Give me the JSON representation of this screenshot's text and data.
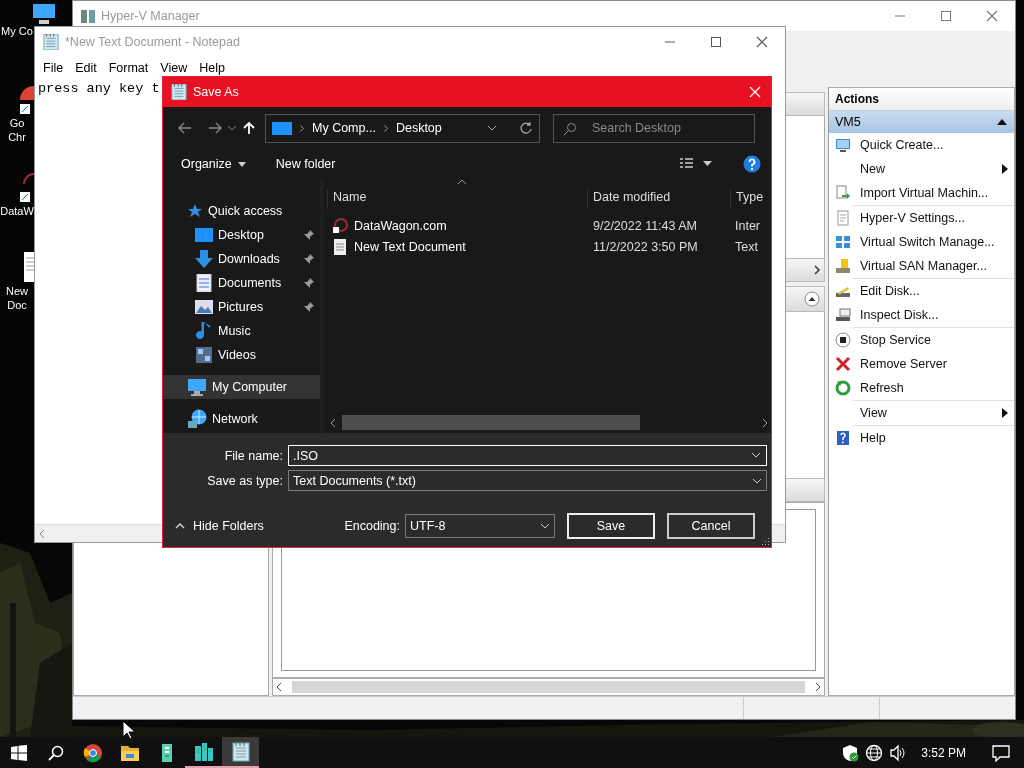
{
  "desktop": {
    "icons": [
      {
        "label": "My Co"
      },
      {
        "label": "Go Chr"
      },
      {
        "label": "DataW"
      },
      {
        "label": "New Doc"
      }
    ]
  },
  "hyperv": {
    "title": "Hyper-V Manager",
    "actions": {
      "title": "Actions",
      "group": "VM5",
      "groups": [
        {
          "items": [
            {
              "label": "Quick Create...",
              "submenu": false
            },
            {
              "label": "New",
              "submenu": true
            },
            {
              "label": "Import Virtual Machin...",
              "submenu": false
            }
          ]
        },
        {
          "items": [
            {
              "label": "Hyper-V Settings...",
              "submenu": false
            },
            {
              "label": "Virtual Switch Manage...",
              "submenu": false
            },
            {
              "label": "Virtual SAN Manager...",
              "submenu": false
            }
          ]
        },
        {
          "items": [
            {
              "label": "Edit Disk...",
              "submenu": false
            },
            {
              "label": "Inspect Disk...",
              "submenu": false
            }
          ]
        },
        {
          "items": [
            {
              "label": "Stop Service",
              "submenu": false
            },
            {
              "label": "Remove Server",
              "submenu": false
            },
            {
              "label": "Refresh",
              "submenu": false
            }
          ]
        },
        {
          "items": [
            {
              "label": "View",
              "submenu": true
            }
          ]
        },
        {
          "items": [
            {
              "label": "Help",
              "submenu": false
            }
          ]
        }
      ]
    }
  },
  "notepad": {
    "title": "*New Text Document - Notepad",
    "menu": [
      "File",
      "Edit",
      "Format",
      "View",
      "Help"
    ],
    "text": "press any key t"
  },
  "dialog": {
    "title": "Save As",
    "breadcrumb": [
      "My Comp...",
      "Desktop"
    ],
    "search": {
      "placeholder": "Search Desktop"
    },
    "toolbar": [
      "Organize",
      "New folder"
    ],
    "nav": [
      {
        "label": "Quick access",
        "selected": false,
        "children": [
          {
            "label": "Desktop",
            "pinned": true,
            "selected": false
          },
          {
            "label": "Downloads",
            "pinned": true,
            "selected": false
          },
          {
            "label": "Documents",
            "pinned": true,
            "selected": false
          },
          {
            "label": "Pictures",
            "pinned": true,
            "selected": false
          },
          {
            "label": "Music",
            "pinned": false,
            "selected": false
          },
          {
            "label": "Videos",
            "pinned": false,
            "selected": false
          }
        ]
      },
      {
        "label": "My Computer",
        "selected": true
      },
      {
        "label": "Network",
        "selected": false
      }
    ],
    "columns": [
      "Name",
      "Date modified",
      "Type"
    ],
    "files": [
      {
        "name": "DataWagon.com",
        "date": "9/2/2022 11:43 AM",
        "type": "Inter"
      },
      {
        "name": "New Text Document",
        "date": "11/2/2022 3:50 PM",
        "type": "Text"
      }
    ],
    "file_name_label": "File name:",
    "file_name": ".ISO",
    "type_label": "Save as type:",
    "type_value": "Text Documents (*.txt)",
    "hide_folders": "Hide Folders",
    "encoding_label": "Encoding:",
    "encoding": "UTF-8",
    "buttons": [
      "Save",
      "Cancel"
    ]
  },
  "taskbar": {
    "apps": [
      {
        "running": false,
        "selected": false
      },
      {
        "running": false,
        "selected": false
      },
      {
        "running": false,
        "selected": false
      },
      {
        "running": true,
        "selected": false
      },
      {
        "running": true,
        "selected": true
      }
    ],
    "clock": "3:52 PM"
  }
}
